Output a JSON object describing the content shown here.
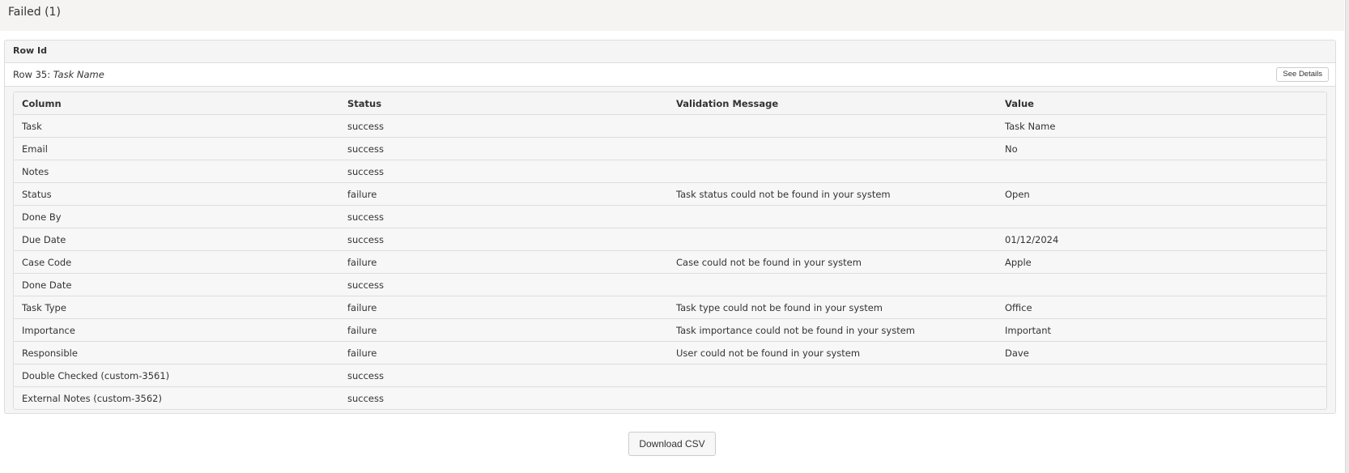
{
  "section": {
    "title": "Failed (1)"
  },
  "panel": {
    "header_label": "Row Id",
    "row_prefix": "Row 35: ",
    "row_task_name": "Task Name",
    "details_button_label": "See Details"
  },
  "table": {
    "headers": [
      "Column",
      "Status",
      "Validation Message",
      "Value"
    ],
    "rows": [
      {
        "column": "Task",
        "status": "success",
        "message": "",
        "value": "Task Name"
      },
      {
        "column": "Email",
        "status": "success",
        "message": "",
        "value": "No"
      },
      {
        "column": "Notes",
        "status": "success",
        "message": "",
        "value": ""
      },
      {
        "column": "Status",
        "status": "failure",
        "message": "Task status could not be found in your system",
        "value": "Open"
      },
      {
        "column": "Done By",
        "status": "success",
        "message": "",
        "value": ""
      },
      {
        "column": "Due Date",
        "status": "success",
        "message": "",
        "value": "01/12/2024"
      },
      {
        "column": "Case Code",
        "status": "failure",
        "message": "Case could not be found in your system",
        "value": "Apple"
      },
      {
        "column": "Done Date",
        "status": "success",
        "message": "",
        "value": ""
      },
      {
        "column": "Task Type",
        "status": "failure",
        "message": "Task type could not be found in your system",
        "value": "Office"
      },
      {
        "column": "Importance",
        "status": "failure",
        "message": "Task importance could not be found in your system",
        "value": "Important"
      },
      {
        "column": "Responsible",
        "status": "failure",
        "message": "User could not be found in your system",
        "value": "Dave"
      },
      {
        "column": "Double Checked (custom-3561)",
        "status": "success",
        "message": "",
        "value": ""
      },
      {
        "column": "External Notes (custom-3562)",
        "status": "success",
        "message": "",
        "value": ""
      }
    ]
  },
  "footer": {
    "download_button_label": "Download CSV"
  }
}
